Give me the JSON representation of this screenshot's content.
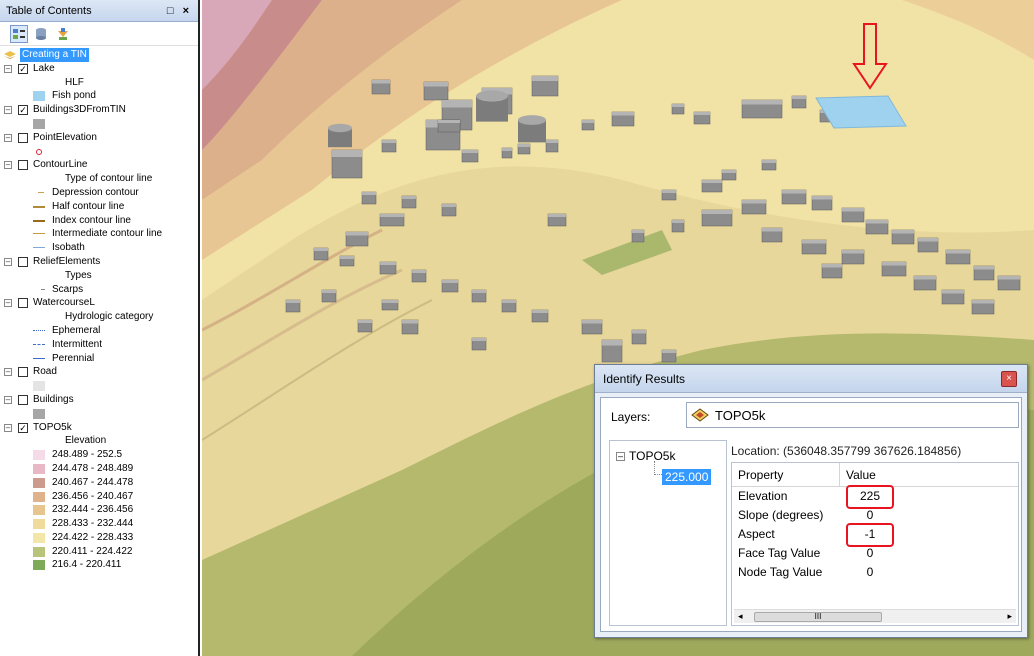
{
  "toc": {
    "title": "Table of Contents",
    "title_buttons": "□ ×",
    "toolbar_icons": [
      "list-by-drawing-order-icon",
      "list-by-source-icon",
      "list-by-visibility-icon"
    ],
    "data_frame": "Creating a TIN",
    "layers": {
      "lake": {
        "name": "Lake",
        "checked": true,
        "sub": "HLF",
        "legend": "Fish pond",
        "color": "#9fd2ee"
      },
      "buildings3d": {
        "name": "Buildings3DFromTIN",
        "checked": true,
        "color": "#a6a6a6"
      },
      "pointelev": {
        "name": "PointElevation",
        "checked": false
      },
      "contour": {
        "name": "ContourLine",
        "checked": false,
        "sub": "Type of contour line",
        "items": [
          {
            "label": "Depression contour",
            "color": "#c8a056"
          },
          {
            "label": "Half contour line",
            "color": "#b08a3a"
          },
          {
            "label": "Index contour line",
            "color": "#9a6a1a"
          },
          {
            "label": "Intermediate contour line",
            "color": "#c49a46"
          },
          {
            "label": "Isobath",
            "color": "#7fa9d8"
          }
        ]
      },
      "relief": {
        "name": "ReliefElements",
        "checked": false,
        "sub": "Types",
        "items": [
          {
            "label": "Scarps"
          }
        ]
      },
      "watercourse": {
        "name": "WatercourseL",
        "checked": false,
        "sub": "Hydrologic category",
        "items": [
          {
            "label": "Ephemeral",
            "color": "#3a6ec8"
          },
          {
            "label": "Intermittent",
            "color": "#3a6ec8"
          },
          {
            "label": "Perennial",
            "color": "#3a6ec8"
          }
        ]
      },
      "road": {
        "name": "Road",
        "checked": false
      },
      "buildings": {
        "name": "Buildings",
        "checked": false
      },
      "topo": {
        "name": "TOPO5k",
        "checked": true,
        "sub": "Elevation",
        "classes": [
          {
            "label": "248.489 - 252.5",
            "color": "#f5dbe8"
          },
          {
            "label": "244.478 - 248.489",
            "color": "#e8b8c6"
          },
          {
            "label": "240.467 - 244.478",
            "color": "#cc9b8e"
          },
          {
            "label": "236.456 - 240.467",
            "color": "#e0b28c"
          },
          {
            "label": "232.444 - 236.456",
            "color": "#e8c48e"
          },
          {
            "label": "228.433 - 232.444",
            "color": "#f0da9c"
          },
          {
            "label": "224.422 - 228.433",
            "color": "#f2e6a8"
          },
          {
            "label": "220.411 - 224.422",
            "color": "#b8c47a"
          },
          {
            "label": "216.4 - 220.411",
            "color": "#7faa5a"
          }
        ]
      }
    }
  },
  "identify": {
    "title": "Identify Results",
    "close": "×",
    "layers_label": "Layers:",
    "layers_value": "TOPO5k",
    "tree_root": "TOPO5k",
    "tree_child": "225.000",
    "location": "Location: (536048.357799 367626.184856)",
    "headers": {
      "property": "Property",
      "value": "Value"
    },
    "rows": [
      {
        "property": "Elevation",
        "value": "225"
      },
      {
        "property": "Slope (degrees)",
        "value": "0"
      },
      {
        "property": "Aspect",
        "value": "-1"
      },
      {
        "property": "Face Tag Value",
        "value": "0"
      },
      {
        "property": "Node Tag Value",
        "value": "0"
      }
    ],
    "scroll_left": "◂",
    "scroll_right": "▸",
    "scroll_thumb": "III"
  },
  "map": {
    "arrow_color": "#e8141f",
    "fish_pond_color": "#9fd2ee",
    "building_color": "#8c8c8c"
  }
}
